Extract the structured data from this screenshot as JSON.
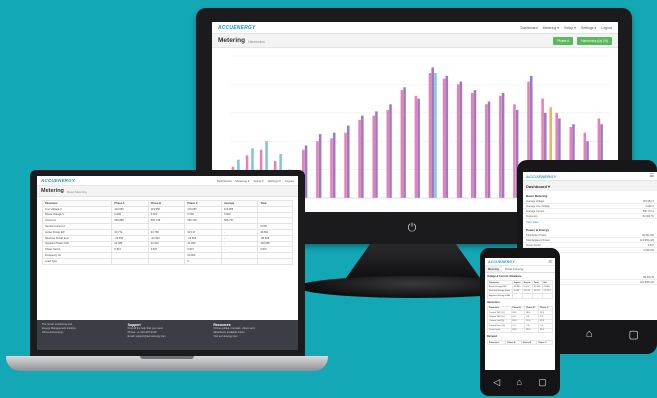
{
  "brand": {
    "logo": "ACCUENERGY",
    "accent": "#1d97c6",
    "background": "#14a7b5",
    "green": "#5cb85c"
  },
  "monitor": {
    "nav": [
      "Dashboard",
      "Metering ▾",
      "Setup ▾",
      "Settings ▾",
      "Logout"
    ],
    "title": "Metering",
    "subtitle": "Harmonics",
    "buttons": [
      "Phase A",
      "Harmonics (Ia)  (%)"
    ],
    "power_icon": "⏻",
    "chart_data": {
      "type": "bar",
      "series_colors": [
        "#e87fb7",
        "#9b7cc4",
        "#7ec7dc",
        "#f0b15a"
      ],
      "bars": [
        [
          22,
          0,
          27,
          0
        ],
        [
          30,
          0,
          35,
          0
        ],
        [
          34,
          0,
          40,
          0
        ],
        [
          26,
          0,
          31,
          0
        ],
        [
          20,
          14,
          0,
          0
        ],
        [
          34,
          37,
          0,
          0
        ],
        [
          40,
          45,
          0,
          0
        ],
        [
          42,
          46,
          0,
          0
        ],
        [
          46,
          51,
          0,
          0
        ],
        [
          55,
          58,
          0,
          0
        ],
        [
          58,
          61,
          0,
          0
        ],
        [
          62,
          66,
          0,
          0
        ],
        [
          76,
          78,
          0,
          0
        ],
        [
          72,
          70,
          0,
          0
        ],
        [
          88,
          92,
          88,
          0
        ],
        [
          84,
          86,
          0,
          0
        ],
        [
          80,
          82,
          0,
          0
        ],
        [
          74,
          76,
          0,
          0
        ],
        [
          66,
          68,
          0,
          0
        ],
        [
          72,
          74,
          0,
          0
        ],
        [
          66,
          62,
          0,
          0
        ],
        [
          82,
          86,
          0,
          0
        ],
        [
          70,
          60,
          0,
          64
        ],
        [
          60,
          56,
          0,
          0
        ],
        [
          50,
          52,
          0,
          0
        ],
        [
          46,
          40,
          0,
          0
        ],
        [
          56,
          52,
          0,
          0
        ]
      ]
    }
  },
  "laptop": {
    "nav": [
      "Dashboard",
      "Metering ▾",
      "Setup ▾",
      "Settings ▾",
      "Logout"
    ],
    "title": "Metering",
    "subtitle": "Basic Metering",
    "table": {
      "headers": [
        "Parameter",
        "Phase A",
        "Phase B",
        "Phase C",
        "Average",
        "Total"
      ],
      "rows": [
        [
          "Line Voltage V",
          "119.953",
          "119.950",
          "119.950",
          "119.955",
          ""
        ],
        [
          "Phase Voltage V",
          "0.000",
          "0.000",
          "0.000",
          "0.000",
          "-"
        ],
        [
          "Current A",
          "560.885",
          "560.738",
          "560.702",
          "560.737",
          ""
        ],
        [
          "Neutral Current A",
          "",
          "",
          "",
          "",
          "0.000"
        ],
        [
          "Active Power kW",
          "33.774",
          "33.780",
          "33.137",
          "-",
          "99.691"
        ],
        [
          "Reactive Power kvar",
          "-23.550",
          "-22.393",
          "-22.666",
          "-",
          "-68.609"
        ],
        [
          "Apparent Power kVA",
          "41.386",
          "41.513",
          "41.060",
          "-",
          "124.959"
        ],
        [
          "Power Factor",
          "0.847",
          "0.847",
          "0.847",
          "-",
          "0.847"
        ],
        [
          "Frequency Hz",
          "",
          "",
          "60.000",
          "",
          ""
        ],
        [
          "Load Type",
          "",
          "",
          "C",
          "",
          ""
        ]
      ]
    },
    "footer": {
      "col1": {
        "head": "",
        "lines": [
          "The Smart monitoring and",
          "Energy Management solution.",
          "About Accuenergy"
        ]
      },
      "col2": {
        "head": "Support",
        "lines": [
          "Find all the help that you need.",
          "Phone: +1-416-497-4100",
          "Email: support@accuenergy.com"
        ]
      },
      "col3": {
        "head": "Resources",
        "lines": [
          "Online guides, manuals, videos and",
          "datasheets available online.",
          "Visit accuenergy.com"
        ]
      }
    }
  },
  "tablet": {
    "header": "Dashboard  ▾",
    "section1": "Basic Metering",
    "rows1": [
      [
        "Average Voltage",
        "119.954 V"
      ],
      [
        "Average Line Voltage",
        "0.000 V"
      ],
      [
        "Average Current",
        "560.737 A"
      ],
      [
        "Frequency",
        "60.000 Hz"
      ]
    ],
    "link1": "View Data",
    "section2": "Power & Energy",
    "rows2": [
      [
        "Total Active Power",
        "99.691 kW"
      ],
      [
        "Total Apparent Power",
        "124.959 kVA"
      ],
      [
        "Power Factor",
        "0.847"
      ],
      [
        "",
        "0.000 kW"
      ]
    ],
    "bottom_rows": [
      [
        "",
        "99.691 W"
      ],
      [
        "",
        "124.959 kVA"
      ]
    ],
    "nav_icons": [
      "◁",
      "⌂",
      "▢"
    ]
  },
  "phone": {
    "logo": "ACCUENERGY",
    "tabs": [
      "Metering",
      "Power & Energy"
    ],
    "section1": "Voltage & Current Unbalance",
    "t1_headers": [
      "Parameter",
      "Import",
      "Export",
      "Total",
      "Net"
    ],
    "t1_rows": [
      [
        "Active Energy kWh",
        "47.880",
        "0.000",
        "47.880",
        "47.880"
      ],
      [
        "Reactive Energy kvarh",
        "0.000",
        "31.512",
        "31.512",
        "-31.512"
      ],
      [
        "Apparent Energy kVAh",
        "",
        "",
        "",
        ""
      ]
    ],
    "section2": "Harmonics",
    "t2_headers": [
      "Parameter",
      "Phase A",
      "Phase B",
      "Phase C"
    ],
    "t2_rows": [
      [
        "Current THD (%)",
        "89.0",
        "88.0",
        "87.0"
      ],
      [
        "Voltage THD (%)",
        "0.0",
        "0.0",
        "0.0"
      ],
      [
        "Current Odd (%)",
        "88.0",
        "87.0",
        "87.0"
      ],
      [
        "Current Even (%)",
        "7.0",
        "7.0",
        "7.0"
      ],
      [
        "Crest Factor",
        "89.0",
        "88.0",
        "89.0"
      ]
    ],
    "section3": "Demand",
    "t3_headers": [
      "Parameter",
      "Phase A",
      "Phase B",
      "Phase C"
    ],
    "nav_icons": [
      "◁",
      "⌂",
      "▢"
    ]
  }
}
